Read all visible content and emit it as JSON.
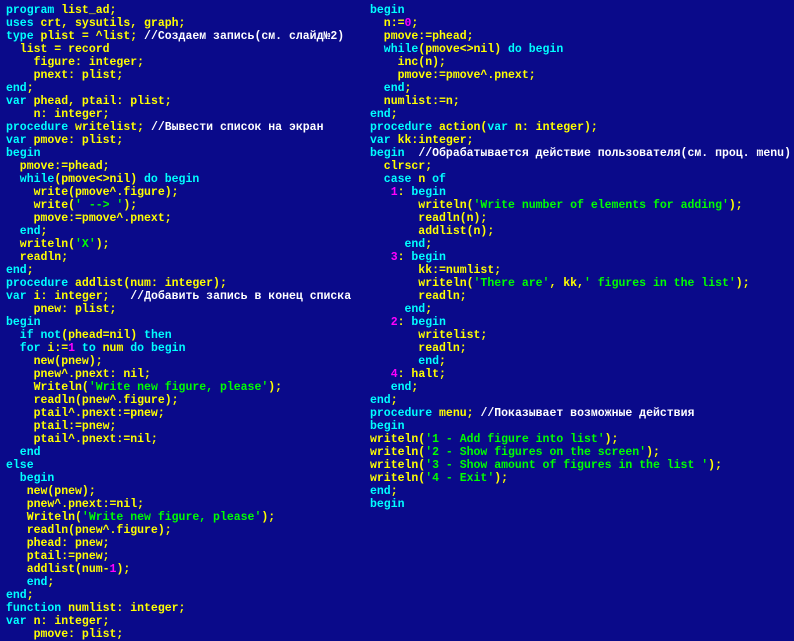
{
  "left": {
    "l01a": "program",
    "l01b": " list_ad;",
    "l02a": "uses",
    "l02b": " crt, sysutils, graph;",
    "l03a": "type",
    "l03b": " plist = ^list;",
    "l03c": " //Создаем запись(см. слайд№2)",
    "l04": "  list = record",
    "l05": "    figure: integer;",
    "l06": "    pnext: plist;",
    "l07a": "end",
    "l07b": ";",
    "l08a": "var",
    "l08b": " phead, ptail: plist;",
    "l09": "    n: integer;",
    "l10a": "procedure",
    "l10b": " writelist;",
    "l10c": " //Вывести список на экран",
    "l11a": "var",
    "l11b": " pmove: plist;",
    "l12": "begin",
    "l13": "  pmove:=phead;",
    "l14a": "  while",
    "l14b": "(pmove<>nil) ",
    "l14c": "do begin",
    "l15a": "    write(pmove^.figure);",
    "l16a": "    write(",
    "l16b": "' --> '",
    "l16c": ");",
    "l17": "    pmove:=pmove^.pnext;",
    "l18a": "  end",
    "l18b": ";",
    "l19a": "  writeln(",
    "l19b": "'X'",
    "l19c": ");",
    "l20": "  readln;",
    "l21a": "end",
    "l21b": ";",
    "l22a": "procedure",
    "l22b": " addlist(num: integer);",
    "l23a": "var",
    "l23b": " i: integer;",
    "l23c": "//Добавить запись в конец списка",
    "l24": "    pnew: plist;",
    "l25": "begin",
    "l26a": "  if not",
    "l26b": "(phead=nil) ",
    "l26c": "then",
    "l27a": "  for",
    "l27b": " i:=",
    "l27c": "1",
    "l27d": " to",
    "l27e": " num ",
    "l27f": "do begin",
    "l28": "    new(pnew);",
    "l29": "    pnew^.pnext: nil;",
    "l30a": "    Writeln(",
    "l30b": "'Write new figure, please'",
    "l30c": ");",
    "l31": "    readln(pnew^.figure);",
    "l32": "    ptail^.pnext:=pnew;",
    "l33": "    ptail:=pnew;",
    "l34": "    ptail^.pnext:=nil;",
    "l35a": "  end",
    "l36": "else",
    "l37": "  begin",
    "l38": "   new(pnew);",
    "l39": "   pnew^.pnext:=nil;",
    "l40a": "   Writeln(",
    "l40b": "'Write new figure, please'",
    "l40c": ");",
    "l41": "   readln(pnew^.figure);",
    "l42": "   phead: pnew;",
    "l43": "   ptail:=pnew;",
    "l44a": "   addlist(num-",
    "l44b": "1",
    "l44c": ");",
    "l45a": "   end",
    "l45b": ";",
    "l46a": "end",
    "l46b": ";",
    "l47a": "function",
    "l47b": " numlist: integer;",
    "l48a": "var",
    "l48b": " n: integer;",
    "l49": "    pmove: plist;"
  },
  "right": {
    "r01": "begin",
    "r02a": "  n:=",
    "r02b": "0",
    "r02c": ";",
    "r03": "  pmove:=phead;",
    "r04a": "  while",
    "r04b": "(pmove<>nil) ",
    "r04c": "do begin",
    "r05": "    inc(n);",
    "r06": "    pmove:=pmove^.pnext;",
    "r07a": "  end",
    "r07b": ";",
    "r08": "  numlist:=n;",
    "r09a": "end",
    "r09b": ";",
    "r10a": "procedure",
    "r10b": " action(",
    "r10c": "var",
    "r10d": " n: integer);",
    "r11a": "var",
    "r11b": " kk:integer;",
    "r12": "begin",
    "r12c": "  //Обрабатывается действие пользователя(см. проц. menu)",
    "r13": "  clrscr;",
    "r14a": "  case",
    "r14b": " n ",
    "r14c": "of",
    "r15a": "   1",
    "r15b": ": ",
    "r15c": "begin",
    "r16a": "       writeln(",
    "r16b": "'Write number of elements for adding'",
    "r16c": ");",
    "r17": "       readln(n);",
    "r18": "       addlist(n);",
    "r19a": "     end",
    "r19b": ";",
    "r20a": "   3",
    "r20b": ": ",
    "r20c": "begin",
    "r21": "       kk:=numlist;",
    "r22a": "       writeln(",
    "r22b": "'There are'",
    "r22c": ", kk,",
    "r22d": "' figures in the list'",
    "r22e": ");",
    "r23": "       readln;",
    "r24a": "     end",
    "r24b": ";",
    "r25a": "   2",
    "r25b": ": ",
    "r25c": "begin",
    "r26": "       writelist;",
    "r27": "       readln;",
    "r28a": "       end",
    "r28b": ";",
    "r29a": "   4",
    "r29b": ": halt;",
    "r30a": "   end",
    "r30b": ";",
    "r31a": "end",
    "r31b": ";",
    "r32a": "procedure",
    "r32b": " menu;",
    "r32c": " //Показывает возможные действия",
    "r33": "begin",
    "r34a": "writeln(",
    "r34b": "'1 - Add figure into list'",
    "r34c": ");",
    "r35a": "writeln(",
    "r35b": "'2 - Show figures on the screen'",
    "r35c": ");",
    "r36a": "writeln(",
    "r36b": "'3 - Show amount of figures in the list '",
    "r36c": ");",
    "r37a": "writeln(",
    "r37b": "'4 - Exit'",
    "r37c": ");",
    "r38a": "end",
    "r38b": ";",
    "r39": "begin"
  }
}
